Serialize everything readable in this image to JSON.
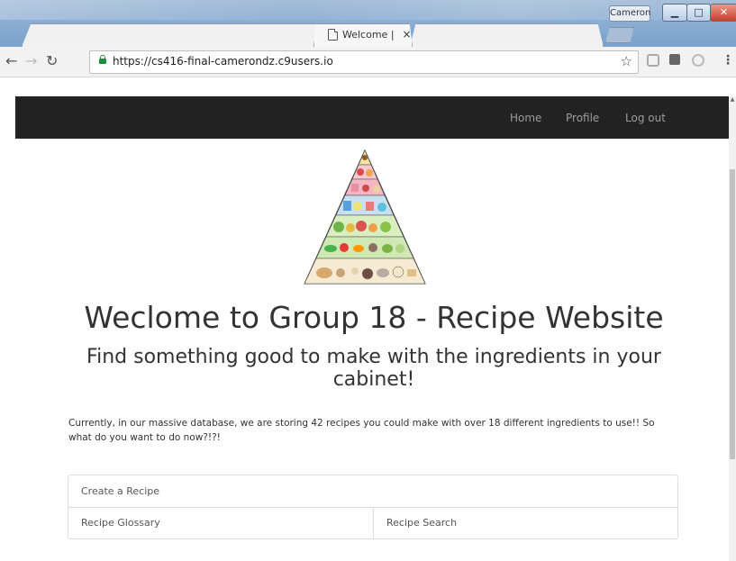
{
  "browser": {
    "user": "Cameron",
    "tabs": [
      {
        "title": "Welcome |",
        "close": "×"
      }
    ],
    "url": "https://cs416-final-camerondz.c9users.io"
  },
  "nav": {
    "home": "Home",
    "profile": "Profile",
    "logout": "Log out"
  },
  "page": {
    "title": "Weclome to Group 18 - Recipe Website",
    "subtitle": "Find something good to make with the ingredients in your cabinet!",
    "intro": "Currently, in our massive database, we are storing 42 recipes you could make with over 18 different ingredients to use!! So what do you want to do now?!?!",
    "actions": {
      "create": "Create a Recipe",
      "glossary": "Recipe Glossary",
      "search": "Recipe Search"
    }
  },
  "colors": {
    "navbar_bg": "#222222",
    "nav_link": "#9d9d9d",
    "text": "#333333",
    "lock": "#1e8e3e"
  }
}
